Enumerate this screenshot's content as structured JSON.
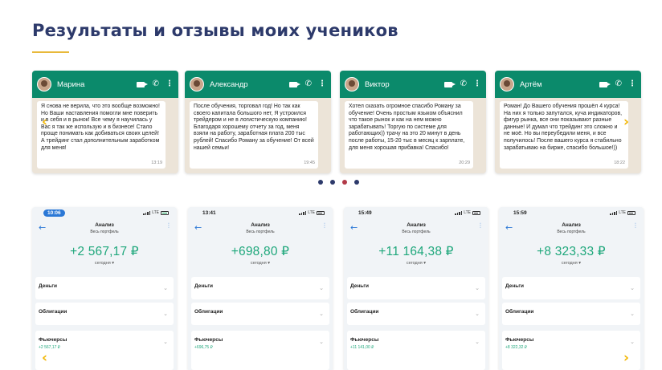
{
  "section": {
    "title": "Результаты и отзывы моих учеников"
  },
  "chats": [
    {
      "name": "Марина",
      "text": "Я снова не верила, что это вообще возможно! Но Ваши наставления помогли мне поверить и в себя и в рынок! Все чему я научилась у Вас я так же использую и в бизнесе! Стало проще понимать как добиваться своих целей! А трейдинг стал дополнительным заработком для меня!",
      "time": "13:19"
    },
    {
      "name": "Александр",
      "text": "После обучения, торговал год! Но так как своего капитала большого нет, Я устроился трейдером и не в логистическую компанию! Благодаря хорошему отчету за год, меня взяли на работу, заработная плата 200 тыс рублей! Спасибо Роману за обучение! От всей нашей семьи!",
      "time": "19:45"
    },
    {
      "name": "Виктор",
      "text": "Хотел сказать огромное спасибо Роману за обучение! Очень простым языком объяснил что такое рынок и как на нем можно зарабатывать! Торгую по системе для работающих)) трачу на это 20 минут в день после работы, 15-20 тыс в месяц к зарплате, для меня хорошая прибавка! Спасибо!",
      "time": "20:29"
    },
    {
      "name": "Артём",
      "text": "Роман! До Вашего обучения прошёл 4 курса! На них я только запутался, куча индикаторов, фигур рынка, все они показывают разные данные! И думал что трейдинг это сложно и не моё. Но вы переубедили меня, и все получилось! После вашего курса я стабильно зарабатываю на бирже, спасибо большое!))",
      "time": "18:22"
    }
  ],
  "arrows": {
    "prev": "‹",
    "next": "›"
  },
  "analysis": [
    {
      "time": "10:06",
      "net": "LTE",
      "title": "Анализ",
      "subtitle": "Весь портфель",
      "amount": "+2 567,17 ₽",
      "period": "сегодня",
      "rows": [
        "Деньги",
        "Облигации",
        "Фьючерсы"
      ],
      "futures_value": "+2 567,17 ₽"
    },
    {
      "time": "13:41",
      "net": "LTE",
      "title": "Анализ",
      "subtitle": "Весь портфель",
      "amount": "+698,80 ₽",
      "period": "сегодня",
      "rows": [
        "Деньги",
        "Облигации",
        "Фьючерсы"
      ],
      "futures_value": "+696,75 ₽"
    },
    {
      "time": "15:49",
      "net": "LTE",
      "title": "Анализ",
      "subtitle": "Весь портфель",
      "amount": "+11 164,38 ₽",
      "period": "сегодня",
      "rows": [
        "Деньги",
        "Облигации",
        "Фьючерсы"
      ],
      "futures_value": "+11 141,00 ₽"
    },
    {
      "time": "15:59",
      "net": "LTE",
      "title": "Анализ",
      "subtitle": "Весь портфель",
      "amount": "+8 323,33 ₽",
      "period": "сегодня",
      "rows": [
        "Деньги",
        "Облигации",
        "Фьючерсы"
      ],
      "futures_value": "+8 322,32 ₽"
    }
  ],
  "colors": {
    "title": "#2d3a6b",
    "accent": "#e8b93a",
    "whatsapp": "#0b8a6b",
    "profit": "#1ea77b"
  }
}
